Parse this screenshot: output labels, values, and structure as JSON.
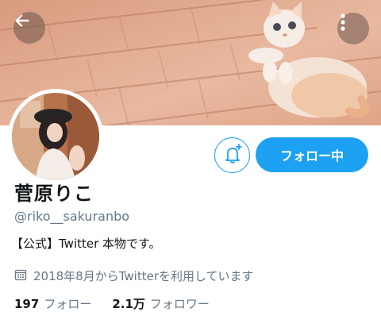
{
  "profile": {
    "display_name": "菅原りこ",
    "handle": "@riko__sakuranbo",
    "bio": "【公式】Twitter 本物です。",
    "joined": "2018年8月からTwitterを利用しています"
  },
  "actions": {
    "following_label": "フォロー中"
  },
  "stats": {
    "following_count": "197",
    "following_label": "フォロー",
    "followers_count": "2.1万",
    "followers_label": "フォロワー"
  },
  "icons": {
    "back": "arrow-left-icon",
    "more": "vertical-dots-icon",
    "notify": "bell-plus-icon",
    "calendar": "calendar-icon"
  },
  "colors": {
    "accent": "#1da1f2",
    "text_primary": "#14171a",
    "text_secondary": "#657786"
  }
}
